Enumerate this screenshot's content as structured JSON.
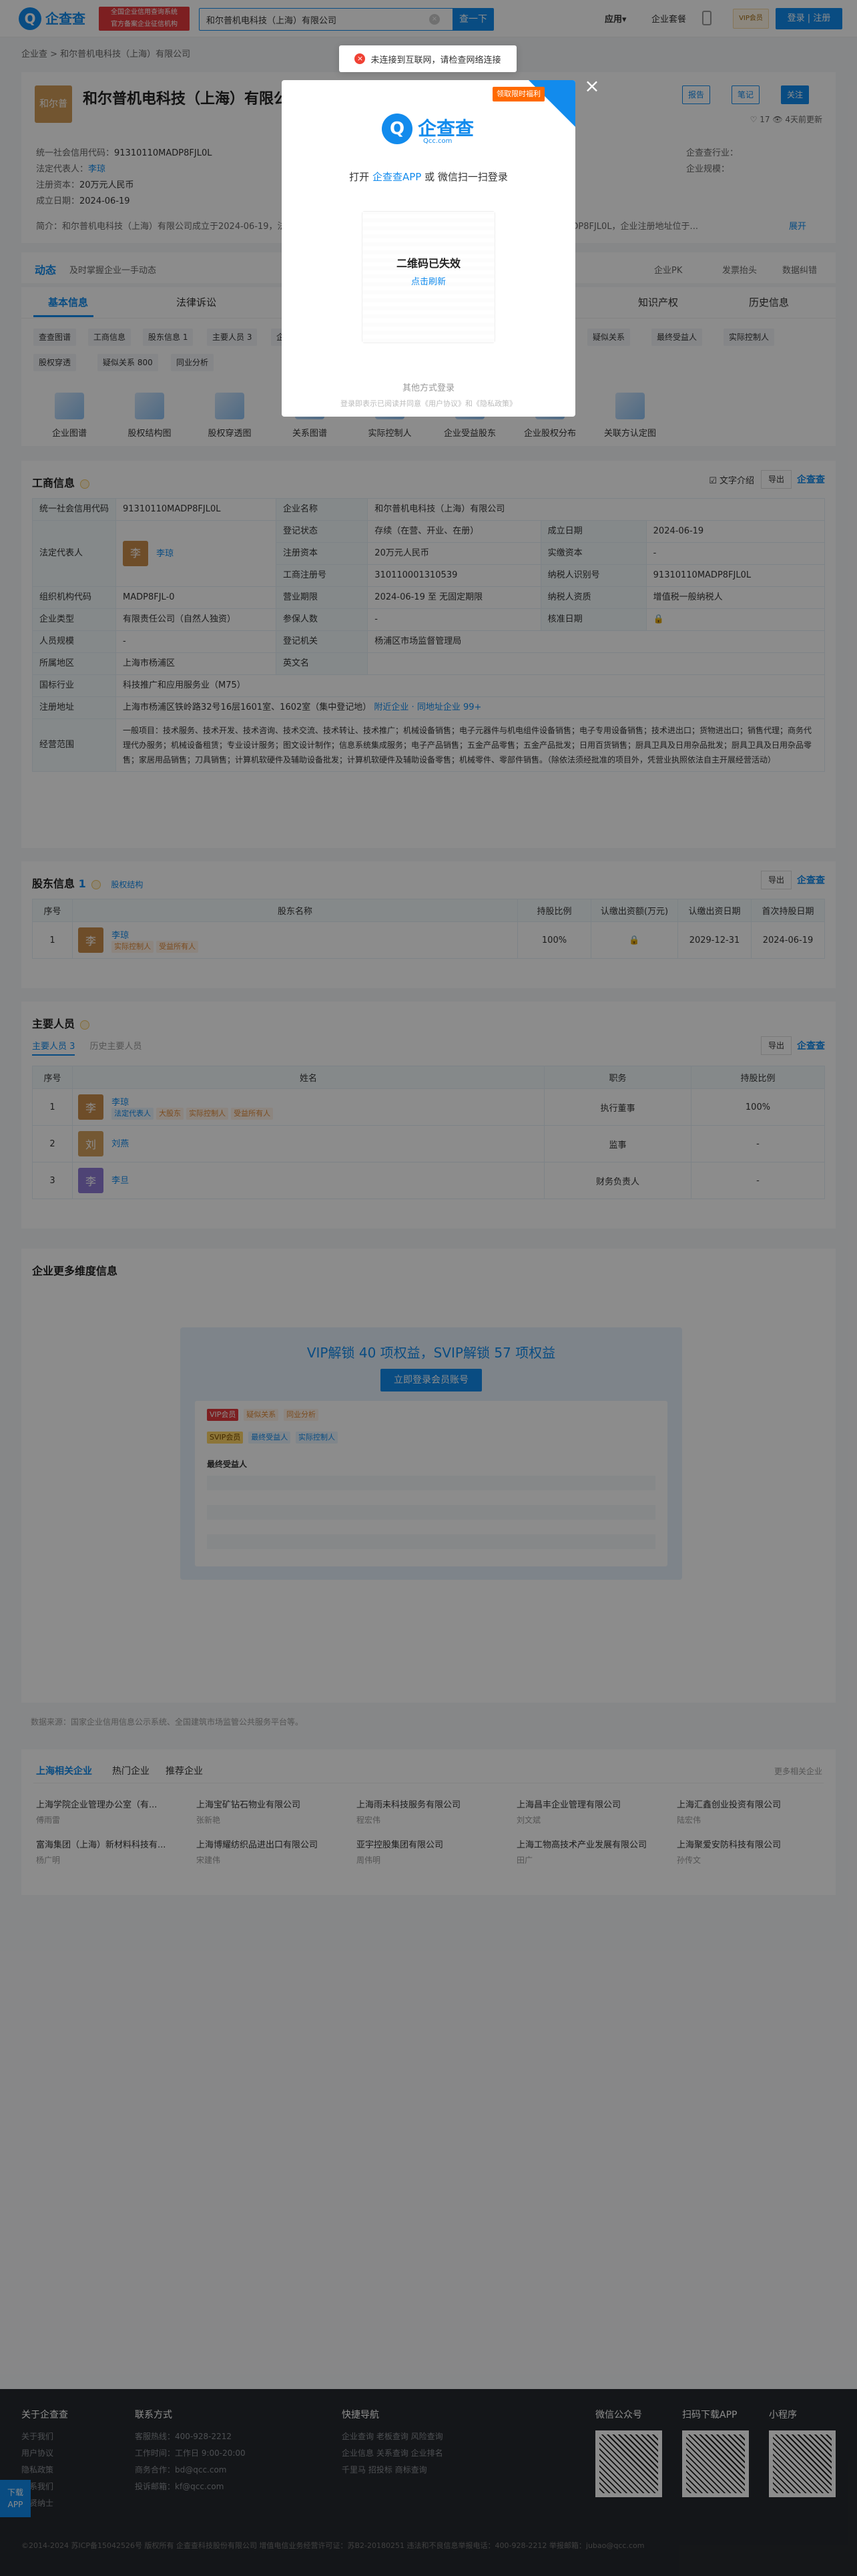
{
  "header": {
    "logo_text": "企查查",
    "logo_sub": "Qcc.com",
    "badge_line1": "全国企业信用查询系统",
    "badge_line2": "官方备案企业征信机构",
    "search_value": "和尔普机电科技（上海）有限公司",
    "search_button": "查一下",
    "nav_app": "应用▾",
    "nav_enterprise": "企业套餐",
    "nav_vip": "VIP会员",
    "login": "登录 | 注册"
  },
  "toast": {
    "icon": "×",
    "message": "未连接到互联网，请检查网络连接"
  },
  "breadcrumb": "企业查 > 和尔普机电科技（上海）有限公司",
  "company": {
    "logo": "和尔普",
    "name": "和尔普机电科技（上海）有限公司",
    "buttons": [
      "报告",
      "笔记",
      "关注"
    ],
    "stats": "♡ 17   👁 4天前更新",
    "credit_code_label": "统一社会信用代码：",
    "credit_code": "91310110MADP8FJL0L",
    "legal_rep_label": "法定代表人：",
    "legal_rep": "李琼",
    "capital_label": "注册资本：",
    "capital": "20万元人民币",
    "date_label": "成立日期：",
    "date": "2024-06-19",
    "right_label1": "企业规模：",
    "right_label2": "企查查行业：",
    "intro": "简介：和尔普机电科技（上海）有限公司成立于2024-06-19，法定代表人为李琼，注册资本为20万元，统一社会信用代码为91310110MADP8FJL0L，企业注册地址位于...",
    "intro_more": "展开"
  },
  "dynamics": {
    "title": "动态",
    "sub": "及时掌握企业一手动态",
    "right": [
      "企业PK",
      "发票抬头",
      "数据纠错"
    ]
  },
  "tabs": {
    "main": [
      "基本信息",
      "法律诉讼",
      "知识产权",
      "历史信息"
    ],
    "sub_row1": [
      "查查图谱",
      "工商信息",
      "股东信息 1",
      "主要人员 3",
      "企业年报",
      "疑似关系",
      "最终受益人",
      "实际控制人"
    ],
    "sub_row2": [
      "股权穿透",
      "疑似关系 800",
      "同业分析"
    ],
    "quick": [
      "企业图谱",
      "股权结构图",
      "股权穿透图",
      "关系图谱",
      "实际控制人",
      "企业受益股东",
      "企业股权分布",
      "关联方认定图"
    ]
  },
  "business": {
    "title": "工商信息",
    "tool_check": "☑ 文字介绍",
    "tool_export": "导出",
    "qcc": "企查查",
    "rows": [
      [
        "统一社会信用代码",
        "91310110MADP8FJL0L",
        "企业名称",
        "和尔普机电科技（上海）有限公司"
      ],
      [
        "登记状态",
        "存续（在营、开业、在册）",
        "成立日期",
        "2024-06-19"
      ],
      [
        "注册资本",
        "20万元人民币",
        "实缴资本",
        "-"
      ],
      [
        "组织机构代码",
        "MADP8FJL-0",
        "工商注册号",
        "310110001310539",
        "纳税人识别号",
        "91310110MADP8FJL0L"
      ],
      [
        "企业类型",
        "有限责任公司（自然人独资）",
        "营业期限",
        "2024-06-19 至 无固定期限",
        "纳税人资质",
        "增值税一般纳税人"
      ],
      [
        "人员规模",
        "-",
        "参保人数",
        "-",
        "核准日期",
        "🔒"
      ],
      [
        "所属地区",
        "上海市杨浦区",
        "登记机关",
        "杨浦区市场监督管理局"
      ],
      [
        "国标行业",
        "科技推广和应用服务业（M75）",
        "英文名",
        ""
      ],
      [
        "注册地址",
        "上海市杨浦区铁岭路32号16层1601室、1602室（集中登记地）",
        "附近企业 · 同地址企业 99+"
      ],
      [
        "经营范围",
        "一般项目：技术服务、技术开发、技术咨询、技术交流、技术转让、技术推广；机械设备销售；电子元器件与机电组件设备销售；电子专用设备销售；技术进出口；货物进出口；销售代理；商务代理代办服务；机械设备租赁；专业设计服务；图文设计制作；信息系统集成服务；电子产品销售；五金产品零售；五金产品批发；日用百货销售；厨具卫具及日用杂品批发；厨具卫具及日用杂品零售；家居用品销售；刀具销售；计算机软硬件及辅助设备批发；计算机软硬件及辅助设备零售；机械零件、零部件销售。（除依法须经批准的项目外，凭营业执照依法自主开展经营活动）"
      ]
    ],
    "legal_rep_name": "李琼"
  },
  "shareholders": {
    "title": "股东信息",
    "count": "1",
    "equity_link": "股权结构",
    "export": "导出",
    "headers": [
      "序号",
      "股东名称",
      "持股比例",
      "认缴出资额(万元)",
      "认缴出资日期",
      "首次持股日期"
    ],
    "rows": [
      {
        "no": "1",
        "avatar": "李",
        "name": "李琼",
        "tags": [
          "实际控制人",
          "受益所有人"
        ],
        "ratio": "100%",
        "amount": "🔒",
        "date": "2029-12-31",
        "first": "2024-06-19"
      }
    ]
  },
  "people": {
    "title": "主要人员",
    "tab_active": "主要人员 3",
    "tab_history": "历史主要人员",
    "export": "导出",
    "headers": [
      "序号",
      "姓名",
      "职务",
      "持股比例"
    ],
    "rows": [
      {
        "no": "1",
        "avatar": "李",
        "name": "李琼",
        "tags": [
          "法定代表人",
          "大股东",
          "实际控制人",
          "受益所有人"
        ],
        "role": "执行董事",
        "ratio": "100%"
      },
      {
        "no": "2",
        "avatar": "刘",
        "name": "刘燕",
        "tags": [],
        "role": "监事",
        "ratio": "-"
      },
      {
        "no": "3",
        "avatar": "李",
        "name": "李旦",
        "tags": [],
        "role": "财务负责人",
        "ratio": "-"
      }
    ]
  },
  "more": {
    "title": "企业更多维度信息",
    "vip_title": "VIP解锁 40 项权益，SVIP解锁 57 项权益",
    "vip_button": "立即登录会员账号",
    "inner_tag": "VIP会员",
    "inner_tags": [
      "疑似关系",
      "同业分析"
    ],
    "inner_svip": "SVIP会员",
    "inner_svip_tags": [
      "最终受益人",
      "实际控制人"
    ],
    "inner_label": "最终受益人"
  },
  "source": "数据来源：国家企业信用信息公示系统、全国建筑市场监管公共服务平台等。",
  "recommend": {
    "tabs": [
      "上海相关企业",
      "热门企业",
      "推荐企业"
    ],
    "more": "更多相关企业",
    "items": [
      {
        "name": "上海学院企业管理办公室（有...",
        "sub": "傅雨雷"
      },
      {
        "name": "上海宝矿钻石物业有限公司",
        "sub": "张新艳"
      },
      {
        "name": "上海雨未科技服务有限公司",
        "sub": "程宏伟"
      },
      {
        "name": "上海昌丰企业管理有限公司",
        "sub": "刘文斌"
      },
      {
        "name": "上海汇鑫创业投资有限公司",
        "sub": "陆宏伟"
      },
      {
        "name": "富海集团（上海）新材料科技有...",
        "sub": "杨广明"
      },
      {
        "name": "上海博耀纺织品进出口有限公司",
        "sub": "宋建伟"
      },
      {
        "name": "亚宇控股集团有限公司",
        "sub": "周伟明"
      },
      {
        "name": "上海工物高技术产业发展有限公司",
        "sub": "田广"
      },
      {
        "name": "上海聚爱安防科技有限公司",
        "sub": "孙传文"
      }
    ]
  },
  "footer": {
    "cols": [
      {
        "title": "关于企查查",
        "items": [
          "关于我们",
          "用户协议",
          "隐私政策",
          "联系我们",
          "招贤纳士"
        ]
      },
      {
        "title": "联系方式",
        "items": [
          "客服热线：400-928-2212",
          "工作时间：工作日 9:00-20:00",
          "商务合作：bd@qcc.com",
          "投诉邮箱：kf@qcc.com"
        ]
      },
      {
        "title": "快捷导航",
        "items": [
          "企业查询  老板查询  风险查询",
          "企业信息  关系查询  企业排名",
          "千里马  招投标  商标查询"
        ]
      }
    ],
    "qr_labels": [
      "微信公众号",
      "扫码下载APP",
      "小程序"
    ],
    "bottom": "©2014-2024 苏ICP备15042526号  版权所有 企查查科技股份有限公司  增值电信业务经营许可证：苏B2-20180251  违法和不良信息举报电话：400-928-2212  举报邮箱：jubao@qcc.com",
    "download": "下载APP"
  },
  "modal": {
    "corner_tag": "领取限时福利",
    "logo_text": "企查查",
    "logo_sub": "Qcc.com",
    "prompt_pre": "打开 ",
    "prompt_app": "企查查APP",
    "prompt_post": " 或 微信扫一扫登录",
    "qr_status": "二维码已失效",
    "qr_refresh": "点击刷新",
    "other": "其他方式登录",
    "agree": "登录即表示已阅读并同意《用户协议》和《隐私政策》",
    "close": "×"
  }
}
